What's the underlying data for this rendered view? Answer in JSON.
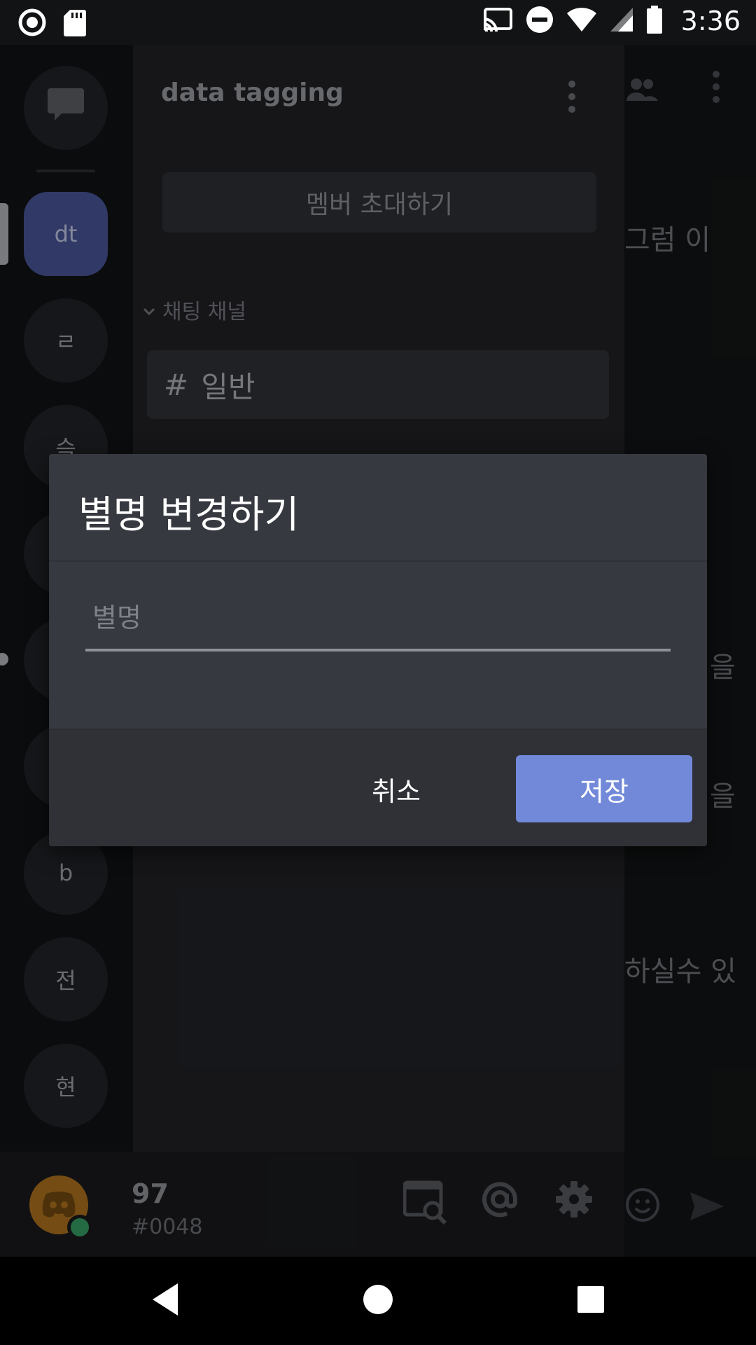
{
  "status_bar": {
    "time": "3:36",
    "icons": [
      "record-icon",
      "sd-card-icon",
      "cast-icon",
      "do-not-disturb-icon",
      "wifi-icon",
      "cell-signal-icon",
      "battery-icon"
    ]
  },
  "server_rail": {
    "items": [
      {
        "label": "",
        "icon": "direct-messages-icon"
      },
      {
        "label": "dt",
        "active": true
      },
      {
        "label": "ㄹ"
      },
      {
        "label": "슥"
      },
      {
        "label": ""
      },
      {
        "label": ""
      },
      {
        "label": ""
      },
      {
        "label": "b"
      },
      {
        "label": "전"
      },
      {
        "label": "현"
      }
    ]
  },
  "drawer": {
    "guild_name": "data tagging",
    "invite_label": "멤버 초대하기",
    "category_label": "채팅 채널",
    "channel": {
      "hash": "#",
      "name": "일반"
    }
  },
  "chat_bg": {
    "lines": [
      "그럼 이",
      "을",
      "을",
      "하실수 있"
    ]
  },
  "user_panel": {
    "name": "97",
    "tag": "#0048"
  },
  "dialog": {
    "title": "별명 변경하기",
    "input_placeholder": "별명",
    "input_value": "",
    "cancel_label": "취소",
    "save_label": "저장",
    "accent": "#7289da"
  }
}
